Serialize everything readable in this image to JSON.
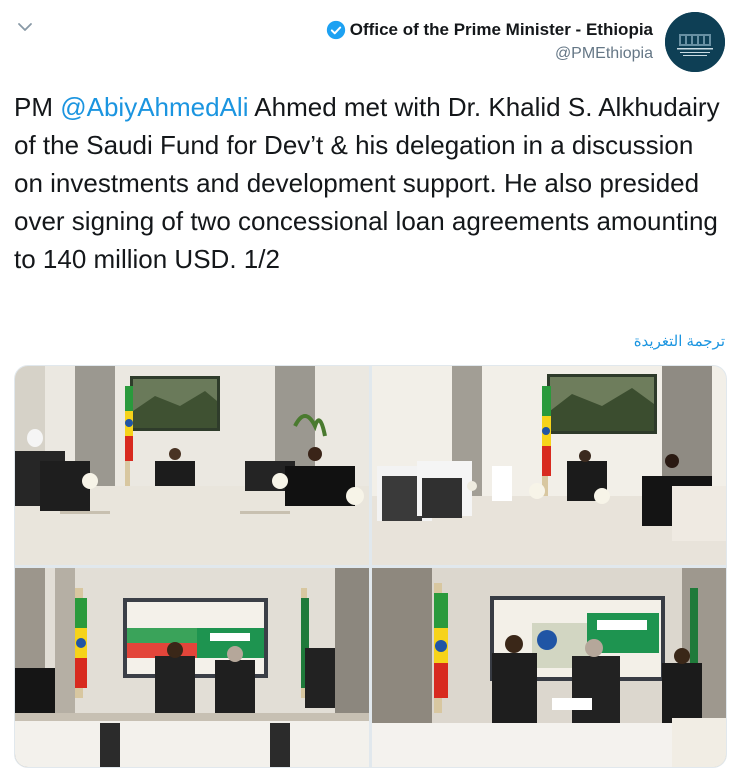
{
  "header": {
    "display_name": "Office of the Prime Minister - Ethiopia",
    "handle": "@PMEthiopia"
  },
  "tweet": {
    "prefix": "PM ",
    "mention": "@AbiyAhmedAli",
    "body": " Ahmed met with Dr. Khalid S. Alkhudairy of the Saudi Fund for Dev’t & his delegation in a discussion on investments and development support. He also presided over signing of two concessional loan agreements amounting to 140 million USD. 1/2"
  },
  "translate_label": "ترجمة التغريدة",
  "colors": {
    "link": "#1b95e0",
    "text": "#14171a",
    "secondary": "#657786",
    "verified": "#1da1f2"
  },
  "icons": {
    "chevron": "chevron-down-icon",
    "verified": "verified-badge-icon"
  }
}
